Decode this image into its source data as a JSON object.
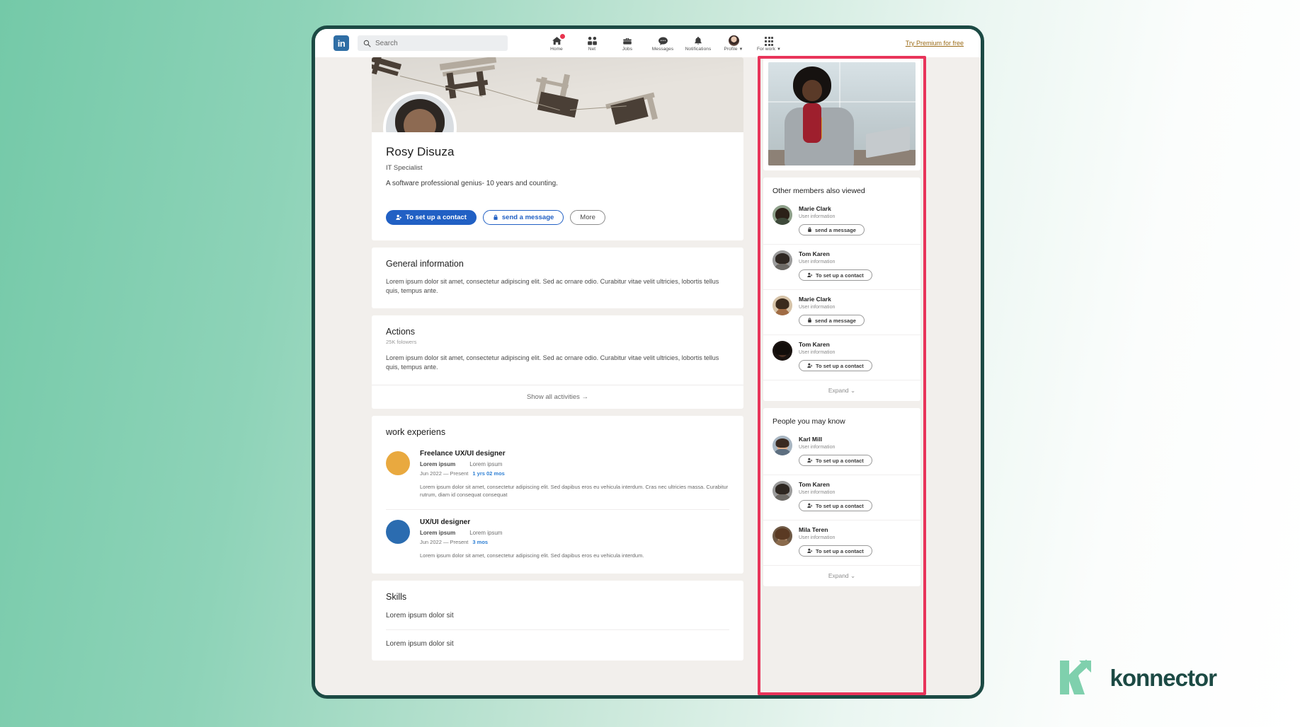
{
  "brand": {
    "logo_text": "in",
    "watermark": "konnector",
    "accent_green": "#7fd0ad",
    "accent_dark": "#1c4a44",
    "highlight_color": "#e8345a"
  },
  "topnav": {
    "search": {
      "placeholder": "Search",
      "value": "",
      "icon": "search-icon"
    },
    "items": [
      {
        "label": "Home",
        "icon": "home-icon",
        "badge": true
      },
      {
        "label": "Net",
        "icon": "network-icon",
        "badge": false
      },
      {
        "label": "Jobs",
        "icon": "briefcase-icon",
        "badge": false
      },
      {
        "label": "Messages",
        "icon": "message-icon",
        "badge": false
      },
      {
        "label": "Notifications",
        "icon": "bell-icon",
        "badge": false
      },
      {
        "label": "Profile",
        "icon": "avatar-icon",
        "badge": false
      },
      {
        "label": "For work",
        "icon": "grid-icon",
        "badge": false
      }
    ],
    "premium_link": "Try Premium for free"
  },
  "profile": {
    "name": "Rosy Disuza",
    "title": "IT Specialist",
    "bio": "A software professional genius- 10 years and counting.",
    "actions": [
      {
        "label": "To set up a contact",
        "icon": "add-person-icon",
        "style": "primary"
      },
      {
        "label": "send a message",
        "icon": "lock-icon",
        "style": "outline-blue"
      },
      {
        "label": "More",
        "icon": "",
        "style": "outline-gray"
      }
    ]
  },
  "general_information": {
    "title": "General information",
    "body": "Lorem ipsum dolor sit amet, consectetur adipiscing elit. Sed ac ornare odio. Curabitur vitae velit ultricies, lobortis tellus quis, tempus ante."
  },
  "actions_section": {
    "title": "Actions",
    "followers": "25K folowers",
    "body": "Lorem ipsum dolor sit amet, consectetur adipiscing elit. Sed ac ornare odio. Curabitur vitae velit ultricies, lobortis tellus quis, tempus ante.",
    "show_all": "Show all activities  →"
  },
  "work": {
    "title": "work experiens",
    "items": [
      {
        "role": "Freelance UX/UI designer",
        "company": "Lorem ipsum",
        "location": "Lorem ipsum",
        "dates": "Jun 2022 — Present",
        "duration": "1 yrs 02 mos",
        "description": "Lorem ipsum dolor sit amet, consectetur adipiscing elit. Sed dapibus eros eu vehicula interdum. Cras nec ultricies massa. Curabitur rutrum, diam id consequat consequat",
        "color": "#e9a93f"
      },
      {
        "role": "UX/UI designer",
        "company": "Lorem ipsum",
        "location": "Lorem ipsum",
        "dates": "Jun 2022 — Present",
        "duration": "3 mos",
        "description": "Lorem ipsum dolor sit amet, consectetur adipiscing elit. Sed dapibus eros eu vehicula interdum.",
        "color": "#2b6cb0"
      }
    ]
  },
  "skills": {
    "title": "Skills",
    "items": [
      "Lorem ipsum dolor sit",
      "Lorem ipsum dolor sit"
    ]
  },
  "sidebar": {
    "also_viewed": {
      "title": "Other members also viewed",
      "expand": "Expand",
      "people": [
        {
          "name": "Marie Clark",
          "sub": "User information",
          "action": "send a message",
          "action_icon": "lock-icon",
          "skin": "#d8a98a",
          "hair": "#2b2118",
          "bg": "#8ea08a"
        },
        {
          "name": "Tom Karen",
          "sub": "User information",
          "action": "To set up a contact",
          "action_icon": "add-person-icon",
          "skin": "#d9b392",
          "hair": "#2e2722",
          "bg": "#9b9b9b"
        },
        {
          "name": "Marie Clark",
          "sub": "User information",
          "action": "send a message",
          "action_icon": "lock-icon",
          "skin": "#b87a4e",
          "hair": "#3a2a1c",
          "bg": "#d6c3a8"
        },
        {
          "name": "Tom Karen",
          "sub": "User information",
          "action": "To set up a contact",
          "action_icon": "add-person-icon",
          "skin": "#4a2f22",
          "hair": "#120d0a",
          "bg": "#1b1411"
        }
      ]
    },
    "may_know": {
      "title": "People you may know",
      "expand": "Expand",
      "people": [
        {
          "name": "Karl Mill",
          "sub": "User information",
          "action": "To set up a contact",
          "action_icon": "add-person-icon",
          "skin": "#dcae8c",
          "hair": "#3a2a20",
          "bg": "#a8b6c2"
        },
        {
          "name": "Tom Karen",
          "sub": "User information",
          "action": "To set up a contact",
          "action_icon": "add-person-icon",
          "skin": "#d9b392",
          "hair": "#2e2722",
          "bg": "#9b9b9b"
        },
        {
          "name": "Mila Teren",
          "sub": "User information",
          "action": "To set up a contact",
          "action_icon": "add-person-icon",
          "skin": "#e3bb9c",
          "hair": "#5a3a23",
          "bg": "#6f5a46"
        }
      ]
    }
  }
}
